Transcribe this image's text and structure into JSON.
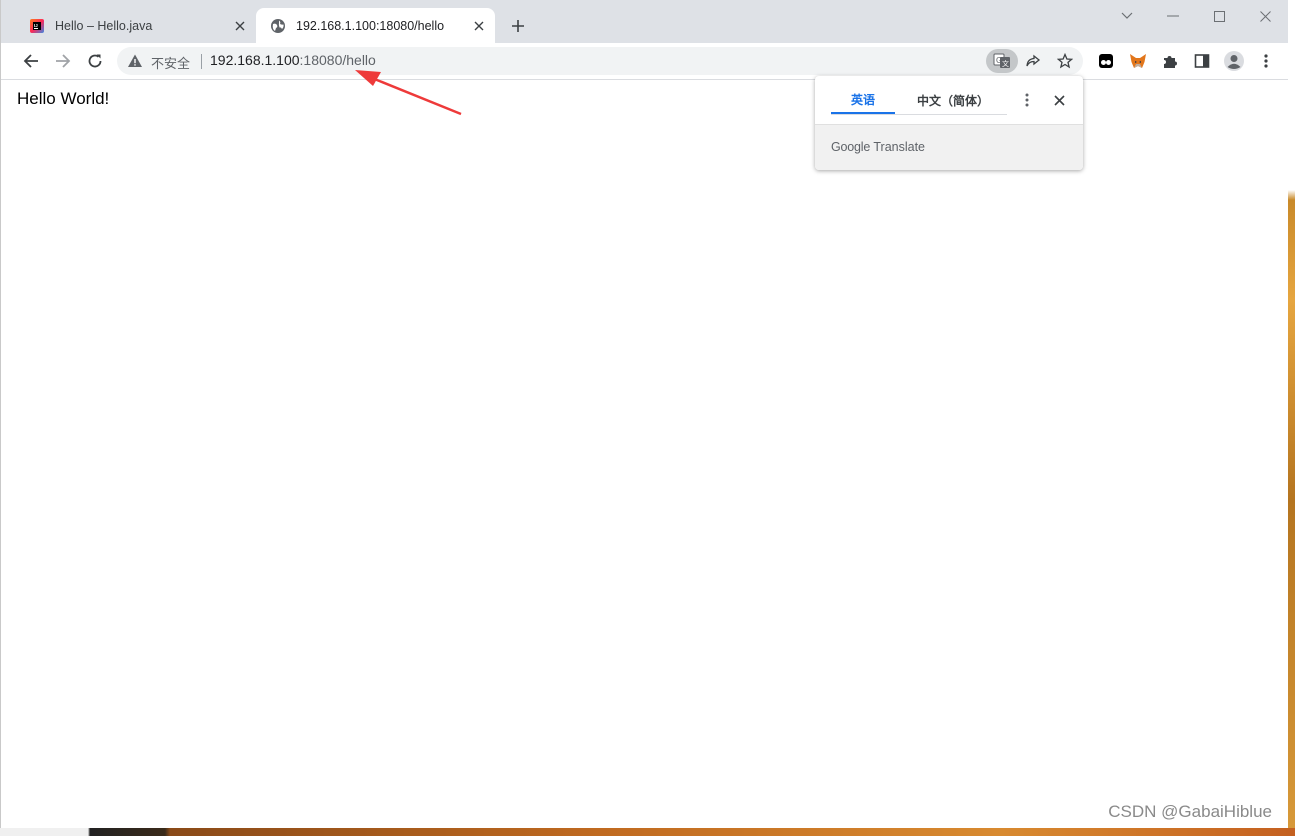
{
  "browser": {
    "tabs": [
      {
        "title": "Hello – Hello.java",
        "active": false,
        "favicon": "intellij-idea-icon"
      },
      {
        "title": "192.168.1.100:18080/hello",
        "active": true,
        "favicon": "globe-icon"
      }
    ],
    "new_tab_label": "+",
    "omnibox": {
      "security_label": "不安全",
      "url_host": "192.168.1.100",
      "url_rest": ":18080/hello"
    }
  },
  "page": {
    "body_text": "Hello World!"
  },
  "translate_bubble": {
    "tabs": [
      {
        "label": "英语",
        "selected": true
      },
      {
        "label": "中文（简体）",
        "selected": false
      }
    ],
    "footer_google": "Google",
    "footer_translate": "Translate"
  },
  "watermark": "CSDN @GabaiHiblue",
  "colors": {
    "tabstrip_bg": "#dee1e6",
    "accent_blue": "#1a73e8",
    "annotation_arrow": "#ee3a3a"
  }
}
